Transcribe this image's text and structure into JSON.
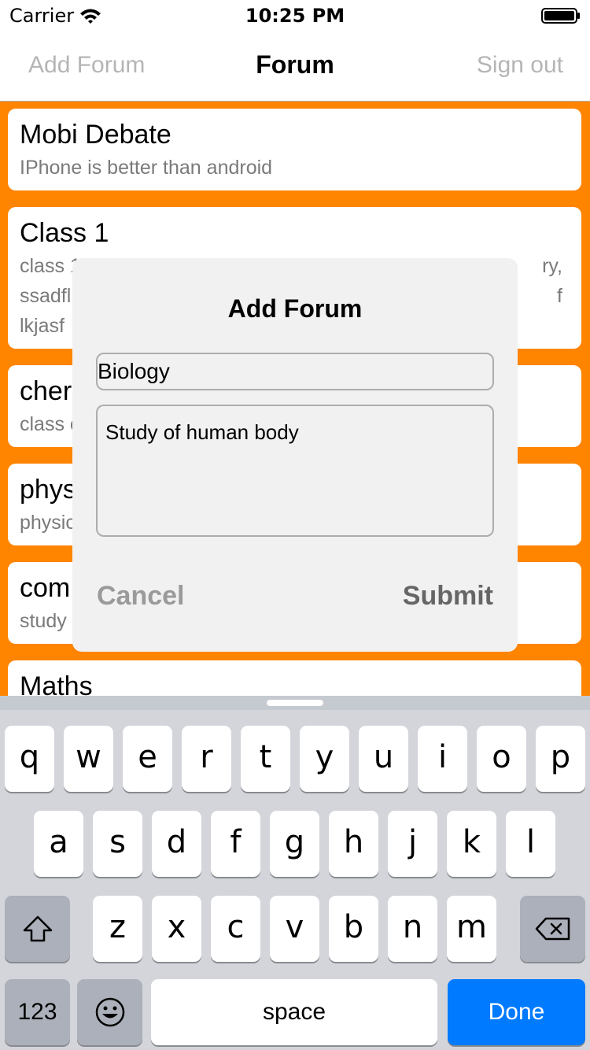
{
  "status_bar": {
    "carrier": "Carrier",
    "time": "10:25 PM"
  },
  "nav": {
    "left": "Add Forum",
    "title": "Forum",
    "right": "Sign out"
  },
  "forums": [
    {
      "title": "Mobi Debate",
      "desc": "IPhone is better than android"
    },
    {
      "title": "Class 1",
      "desc_lines": [
        "class 1",
        "ssadfl",
        "lkjasf"
      ],
      "desc_right": [
        "ry,",
        "f"
      ]
    },
    {
      "title": "cher",
      "desc": "class c"
    },
    {
      "title": "phys",
      "desc": "physic"
    },
    {
      "title": "com",
      "desc": "study"
    },
    {
      "title": "Maths",
      "desc": ""
    }
  ],
  "dialog": {
    "title": "Add Forum",
    "name_value": "Biology",
    "description_value": "Study of human body",
    "cancel_label": "Cancel",
    "submit_label": "Submit"
  },
  "keyboard": {
    "row1": [
      "q",
      "w",
      "e",
      "r",
      "t",
      "y",
      "u",
      "i",
      "o",
      "p"
    ],
    "row2": [
      "a",
      "s",
      "d",
      "f",
      "g",
      "h",
      "j",
      "k",
      "l"
    ],
    "row3": [
      "z",
      "x",
      "c",
      "v",
      "b",
      "n",
      "m"
    ],
    "numbers_label": "123",
    "space_label": "space",
    "done_label": "Done",
    "done_color": "#007aff"
  },
  "colors": {
    "background": "#ff8400",
    "dialog": "#f1f1f1"
  }
}
